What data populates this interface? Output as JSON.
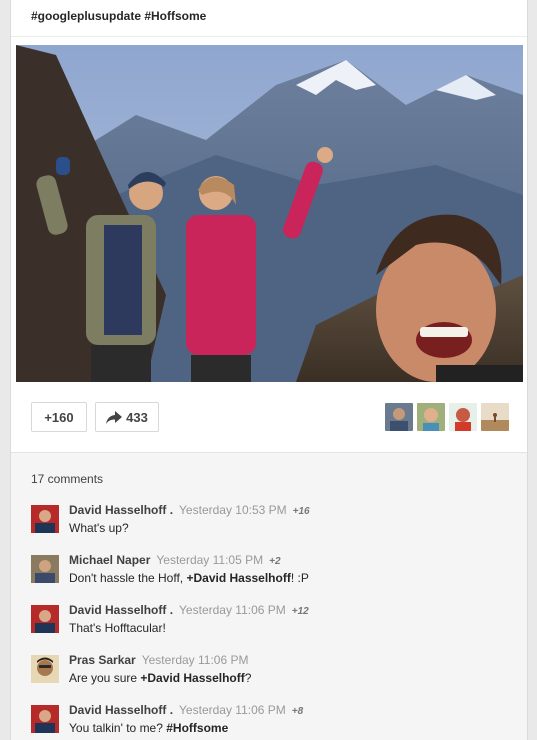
{
  "post": {
    "hashtags": "#googleplusupdate #Hoffsome",
    "plus_label": "+160",
    "share_count": "433"
  },
  "comments": {
    "count_label": "17 comments",
    "items": [
      {
        "name": "David Hasselhoff .",
        "time": "Yesterday 10:53 PM",
        "plus": "+16",
        "text_before": "What's up?",
        "mention": "",
        "text_after": ""
      },
      {
        "name": "Michael Naper",
        "time": "Yesterday 11:05 PM",
        "plus": "+2",
        "text_before": "Don't hassle the Hoff, ",
        "mention": "+David Hasselhoff",
        "text_after": "! :P"
      },
      {
        "name": "David Hasselhoff .",
        "time": "Yesterday 11:06 PM",
        "plus": "+12",
        "text_before": "That's Hofftacular!",
        "mention": "",
        "text_after": ""
      },
      {
        "name": "Pras Sarkar",
        "time": "Yesterday 11:06 PM",
        "plus": "",
        "text_before": "Are you sure ",
        "mention": "+David Hasselhoff",
        "text_after": "?"
      },
      {
        "name": "David Hasselhoff .",
        "time": "Yesterday 11:06 PM",
        "plus": "+8",
        "text_before": "You talkin' to me? ",
        "mention": "#Hoffsome",
        "text_after": ""
      }
    ]
  }
}
